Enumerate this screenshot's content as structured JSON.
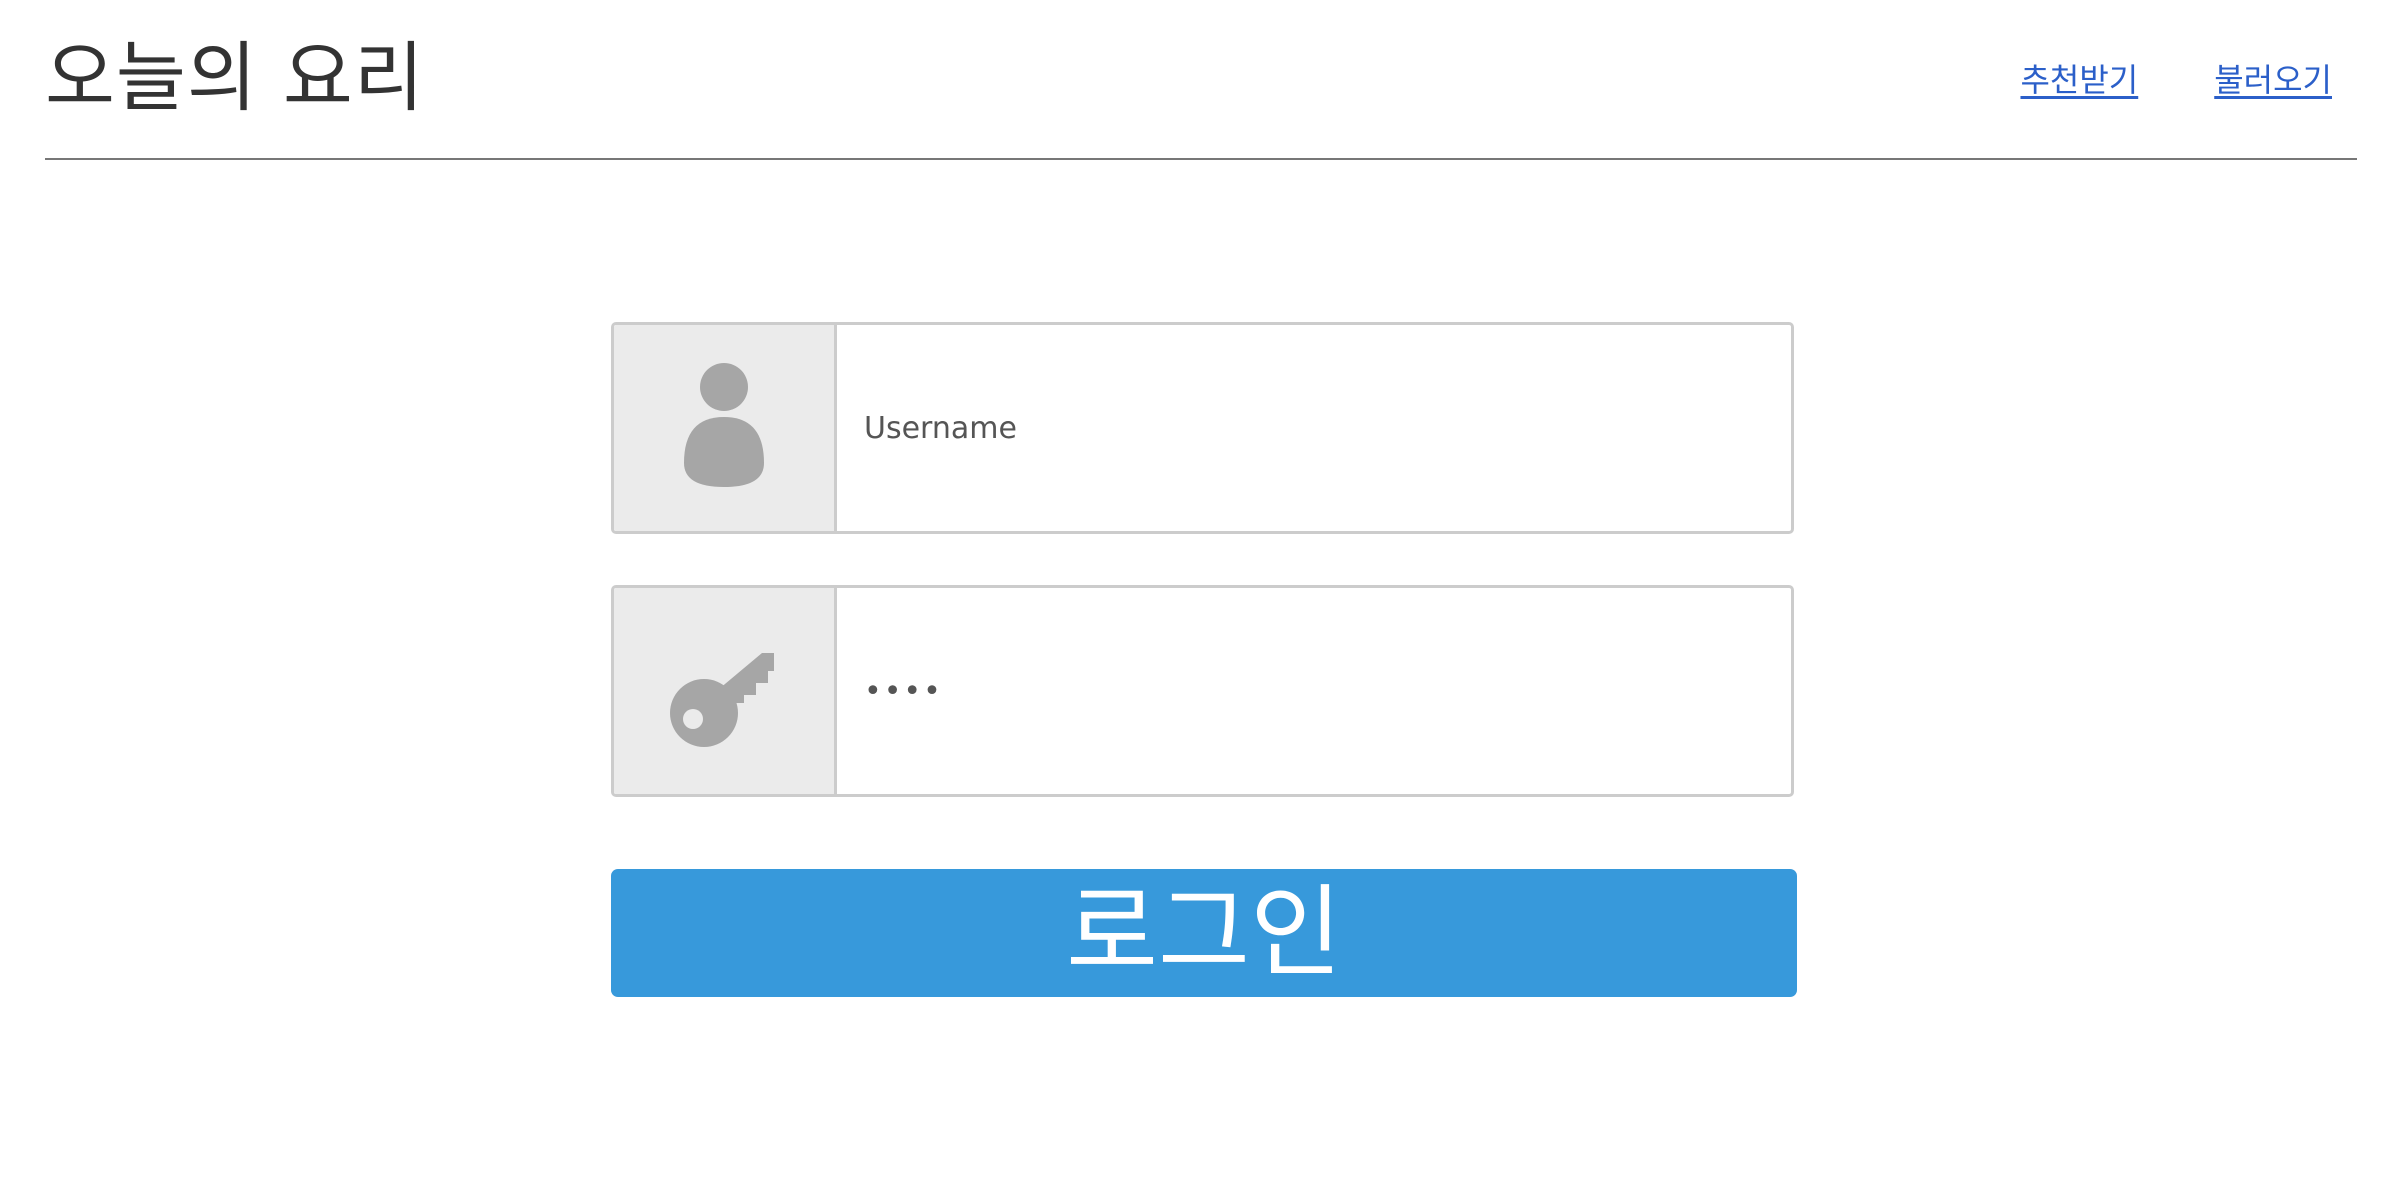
{
  "header": {
    "title": "오늘의 요리",
    "nav": [
      {
        "label": "추천받기"
      },
      {
        "label": "불러오기"
      }
    ]
  },
  "form": {
    "username": {
      "icon": "user-icon",
      "placeholder": "Username",
      "value": ""
    },
    "password": {
      "icon": "key-icon",
      "value": "••••"
    },
    "submit_label": "로그인"
  },
  "colors": {
    "accent": "#3799db",
    "link": "#2b5fc9",
    "icon": "#a6a6a6",
    "addon_bg": "#ebebeb"
  }
}
